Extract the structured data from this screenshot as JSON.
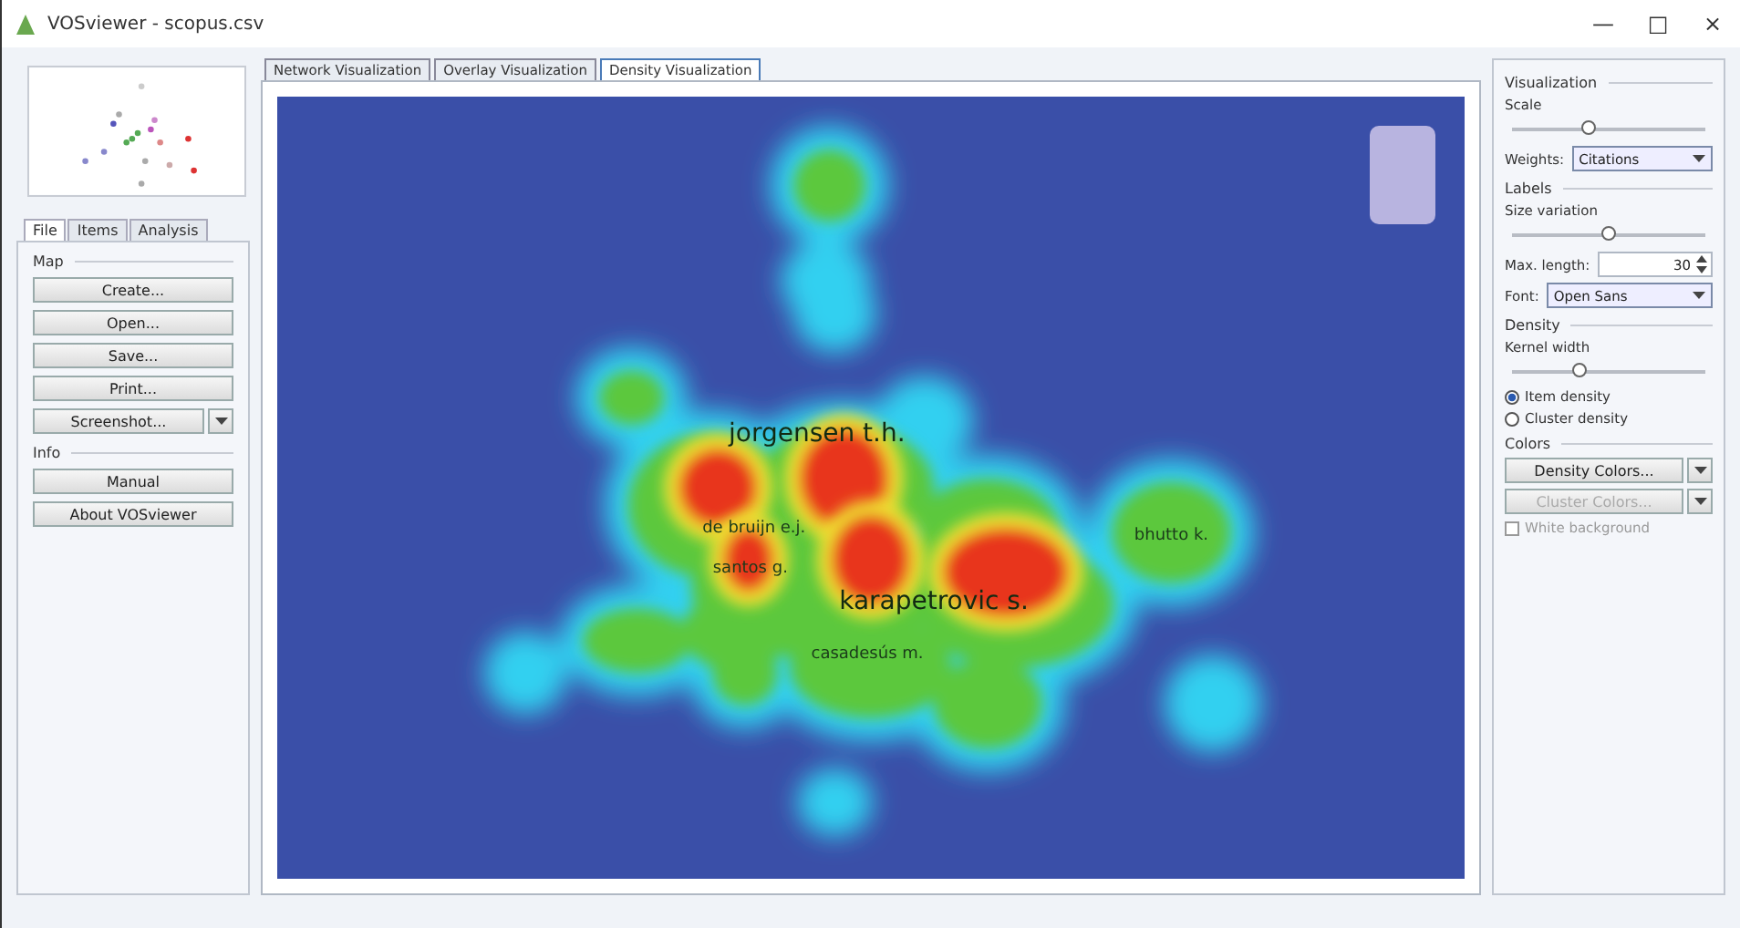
{
  "window": {
    "title": "VOSviewer - scopus.csv",
    "controls": [
      "—",
      "□",
      "×"
    ]
  },
  "left_panel": {
    "tabs": [
      {
        "label": "File",
        "selected": true
      },
      {
        "label": "Items",
        "selected": false
      },
      {
        "label": "Analysis",
        "selected": false
      }
    ],
    "sections": [
      {
        "title": "Map",
        "buttons": [
          {
            "label": "Create...",
            "has_menu": false
          },
          {
            "label": "Open...",
            "has_menu": false
          },
          {
            "label": "Save...",
            "has_menu": false
          },
          {
            "label": "Print...",
            "has_menu": false
          },
          {
            "label": "Screenshot...",
            "has_menu": true
          }
        ]
      },
      {
        "title": "Info",
        "buttons": [
          {
            "label": "Manual",
            "has_menu": false
          },
          {
            "label": "About VOSviewer",
            "has_menu": false
          }
        ]
      }
    ]
  },
  "view_tabs": [
    {
      "label": "Network Visualization",
      "selected": false
    },
    {
      "label": "Overlay Visualization",
      "selected": false
    },
    {
      "label": "Density Visualization",
      "selected": true
    }
  ],
  "map": {
    "labels": [
      {
        "text": "jorgensen t.h.",
        "kind": "major"
      },
      {
        "text": "de bruijn e.j.",
        "kind": "minor"
      },
      {
        "text": "santos g.",
        "kind": "minor"
      },
      {
        "text": "karapetrovic s.",
        "kind": "major"
      },
      {
        "text": "casadesús m.",
        "kind": "minor"
      },
      {
        "text": "bhutto k.",
        "kind": "minor"
      }
    ]
  },
  "right_panel": {
    "visualization": {
      "title": "Visualization",
      "scale_label": "Scale",
      "scale": {
        "level": 0.4
      },
      "weights_label": "Weights:",
      "weights": "Citations"
    },
    "labels": {
      "title": "Labels",
      "size_variation_label": "Size variation",
      "size_variation": {
        "level": 0.5
      },
      "max_length_label": "Max. length:",
      "max_length": "30",
      "font_label": "Font:",
      "font": "Open Sans"
    },
    "density": {
      "title": "Density",
      "kernel_width_label": "Kernel width",
      "kernel_width": {
        "level": 0.35
      },
      "options": [
        {
          "label": "Item density",
          "selected": true
        },
        {
          "label": "Cluster density",
          "selected": false
        }
      ]
    },
    "colors": {
      "title": "Colors",
      "density_colors": {
        "label": "Density Colors...",
        "disabled": false
      },
      "cluster_colors": {
        "label": "Cluster Colors...",
        "disabled": true
      },
      "white_background": {
        "label": "White background",
        "checked": false,
        "disabled": true
      }
    }
  }
}
